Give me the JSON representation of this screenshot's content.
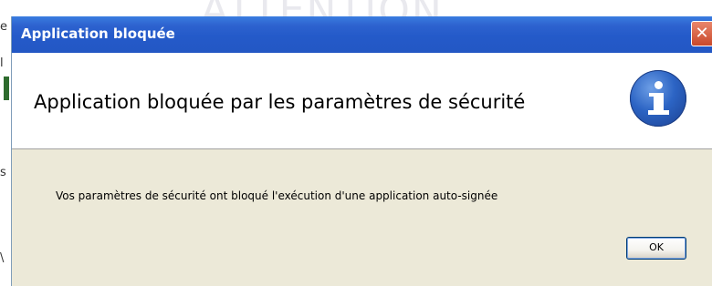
{
  "background": {
    "watermark_text": "ATTENTION",
    "left_edge_chars": [
      "e",
      "l",
      "s",
      "\\"
    ]
  },
  "dialog": {
    "title": "Application bloquée",
    "close_label": "✕",
    "header": "Application bloquée par les paramètres de sécurité",
    "info_icon": "info-icon",
    "message": "Vos paramètres de sécurité ont bloqué l'exécution d'une application auto-signée",
    "ok_label": "OK"
  },
  "colors": {
    "titlebar": "#245ac9",
    "dialog_body": "#ece9d8",
    "close_button": "#c9482a",
    "info_icon": "#2c64c4"
  }
}
